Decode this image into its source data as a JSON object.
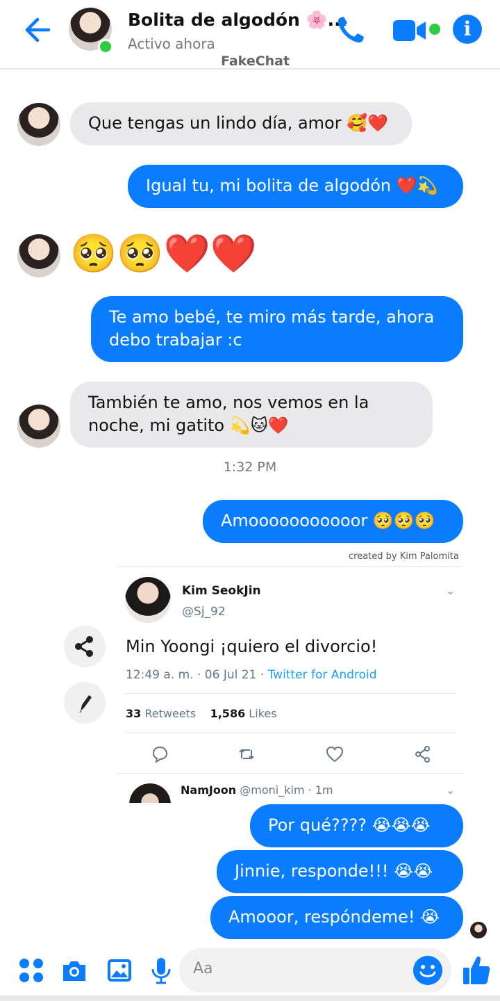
{
  "header": {
    "contact_name": "Bolita de algodón 🌸...",
    "status": "Activo ahora",
    "watermark": "FakeChat"
  },
  "messages": [
    {
      "direction": "in",
      "text": "Que tengas un lindo día, amor 🥰❤️"
    },
    {
      "direction": "out",
      "text": "Igual tu, mi bolita de algodón ❤️💫"
    },
    {
      "direction": "in",
      "text": "🥺🥺❤️❤️"
    },
    {
      "direction": "out",
      "text": "Te amo bebé, te miro más tarde, ahora debo trabajar :c"
    },
    {
      "direction": "in",
      "text": "También te amo, nos vemos en la noche, mi gatito 💫🐱❤️"
    },
    {
      "direction": "out",
      "text": "Amooooooooooor 🥺🥺🥺"
    },
    {
      "direction": "out",
      "text": "Por qué???? 😭😭😭"
    },
    {
      "direction": "out",
      "text": "Jinnie, responde!!! 😭😭"
    },
    {
      "direction": "out",
      "text": "Amooor, respóndeme! 😭"
    }
  ],
  "message_lines": {
    "m4_line1": "Te amo bebé, te miro más tarde, ahora",
    "m4_line2": "debo trabajar :c",
    "m5_line1": "También te amo, nos vemos en la",
    "m5_line2": "noche, mi gatito 💫🐱❤️"
  },
  "timestamp": "1:32 PM",
  "credit": "created by Kim Palomita",
  "tweet": {
    "name": "Kim SeokJin",
    "handle": "@Sj_92",
    "text": "Min Yoongi ¡quiero el divorcio!",
    "date": "12:49 a. m. · 06 Jul 21 · ",
    "client": "Twitter for Android",
    "retweets_count": "33",
    "retweets_label": " Retweets",
    "likes_count": "1,586",
    "likes_label": " Likes",
    "reply_name": "NamJoon",
    "reply_meta": " @moni_kim · 1m"
  },
  "composer": {
    "placeholder": "Aa"
  },
  "colors": {
    "messenger_blue": "#0a7cff",
    "incoming_gray": "#e9e9eb",
    "online_green": "#2ecc40",
    "twitter_blue": "#1da1f2"
  },
  "icons": [
    "back-arrow-icon",
    "phone-icon",
    "video-camera-icon",
    "info-icon",
    "share-icon",
    "pencil-icon",
    "reply-icon",
    "retweet-icon",
    "like-icon",
    "tweet-share-icon",
    "menu-grid-icon",
    "camera-icon",
    "gallery-icon",
    "microphone-icon",
    "emoji-icon",
    "thumbs-up-icon"
  ]
}
